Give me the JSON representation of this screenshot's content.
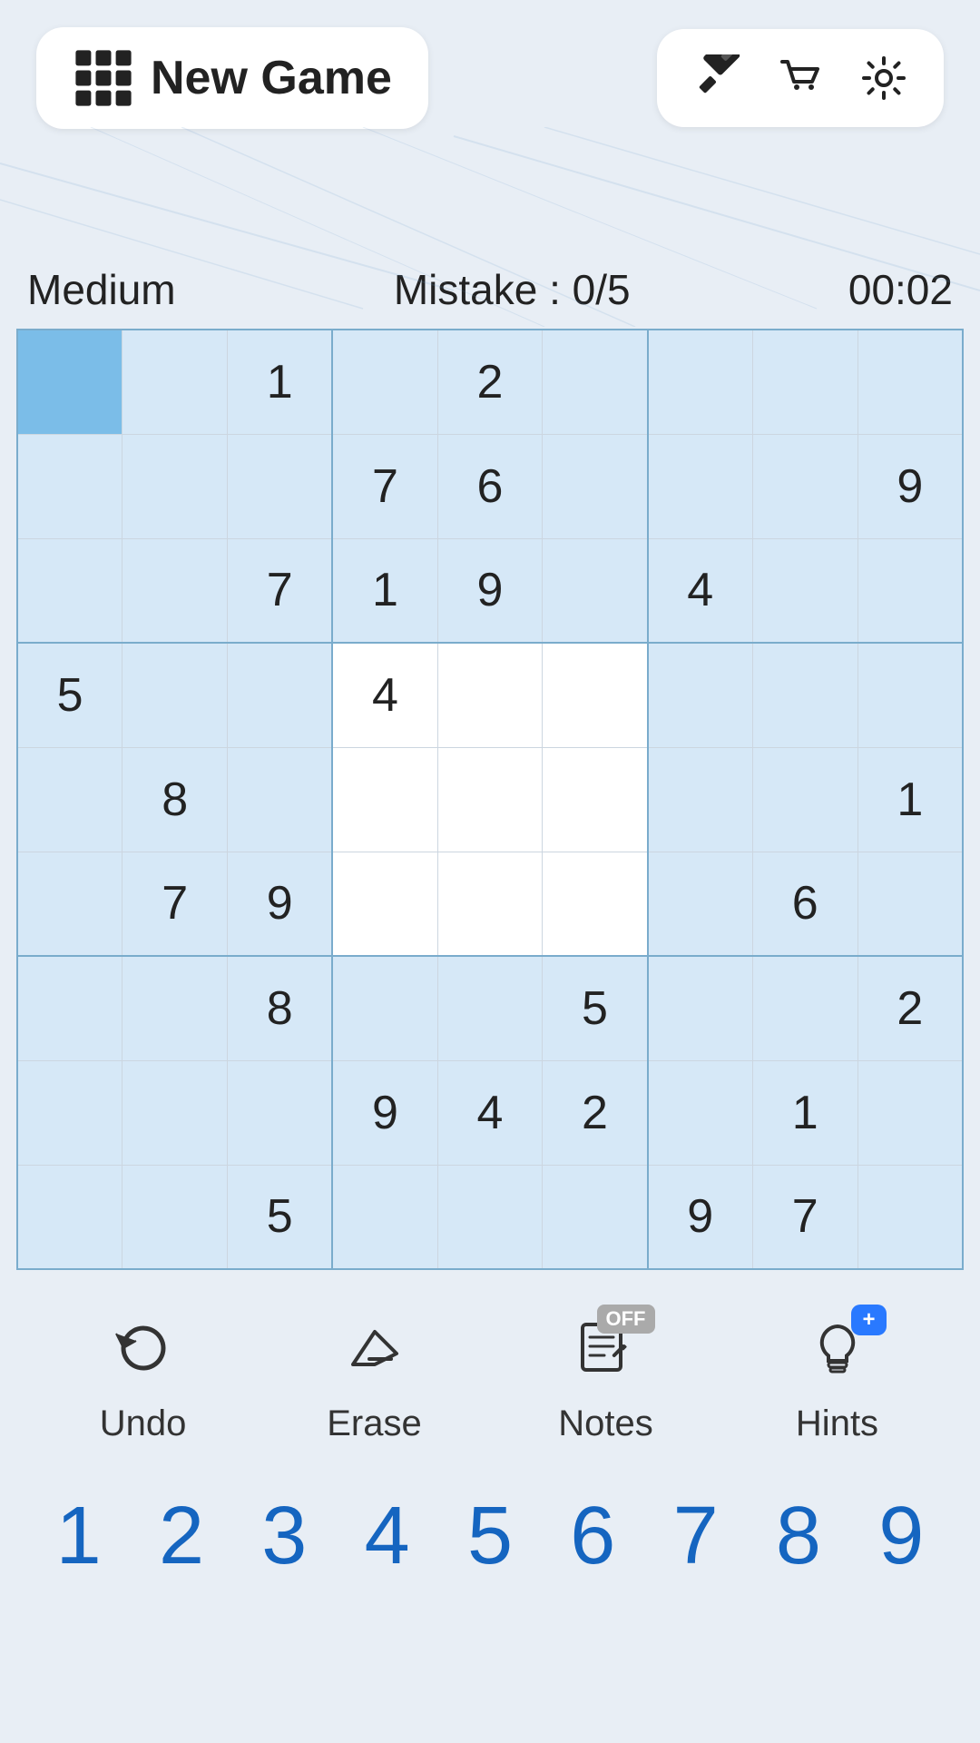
{
  "header": {
    "new_game_label": "New Game",
    "icon_paint": "🖌",
    "icon_cart": "🛒",
    "icon_settings": "⚙️"
  },
  "game_info": {
    "difficulty": "Medium",
    "mistake_label": "Mistake : 0/5",
    "timer": "00:02"
  },
  "grid": {
    "cells": [
      [
        "",
        "",
        "1",
        "",
        "2",
        "",
        "",
        "",
        ""
      ],
      [
        "",
        "",
        "",
        "7",
        "6",
        "",
        "",
        "",
        "9"
      ],
      [
        "",
        "",
        "7",
        "1",
        "9",
        "",
        "4",
        "",
        ""
      ],
      [
        "5",
        "",
        "",
        "4",
        "",
        "",
        "",
        "",
        ""
      ],
      [
        "",
        "8",
        "",
        "",
        "",
        "",
        "",
        "",
        "1"
      ],
      [
        "",
        "7",
        "9",
        "",
        "",
        "",
        "",
        "6",
        ""
      ],
      [
        "",
        "",
        "8",
        "",
        "",
        "5",
        "",
        "",
        "2"
      ],
      [
        "",
        "",
        "",
        "9",
        "4",
        "2",
        "",
        "1",
        ""
      ],
      [
        "",
        "",
        "5",
        "",
        "",
        "",
        "9",
        "7",
        ""
      ]
    ],
    "selected_row": 0,
    "selected_col": 0,
    "blue_cols": [
      0,
      1,
      2,
      6,
      7,
      8
    ],
    "blue_rows": [
      0,
      1,
      2,
      3,
      4,
      5,
      6,
      7,
      8
    ]
  },
  "toolbar": {
    "undo_label": "Undo",
    "erase_label": "Erase",
    "notes_label": "Notes",
    "notes_badge": "OFF",
    "hints_label": "Hints",
    "hints_badge": "+"
  },
  "number_pad": {
    "numbers": [
      "1",
      "2",
      "3",
      "4",
      "5",
      "6",
      "7",
      "8",
      "9"
    ]
  }
}
